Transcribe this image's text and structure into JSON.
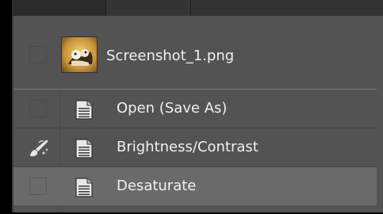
{
  "snapshot": {
    "label": "Screenshot_1.png",
    "thumbnail_icon": "image-thumbnail-icon"
  },
  "history": [
    {
      "label": "Open (Save As)",
      "icon": "document-icon",
      "source_marker": false
    },
    {
      "label": "Brightness/Contrast",
      "icon": "document-icon",
      "source_marker": true
    },
    {
      "label": "Desaturate",
      "icon": "document-icon",
      "source_marker": false,
      "selected": true
    }
  ],
  "colors": {
    "panel": "#535353",
    "selected_row": "#6a6a6a",
    "text": "#f0f0f0"
  }
}
